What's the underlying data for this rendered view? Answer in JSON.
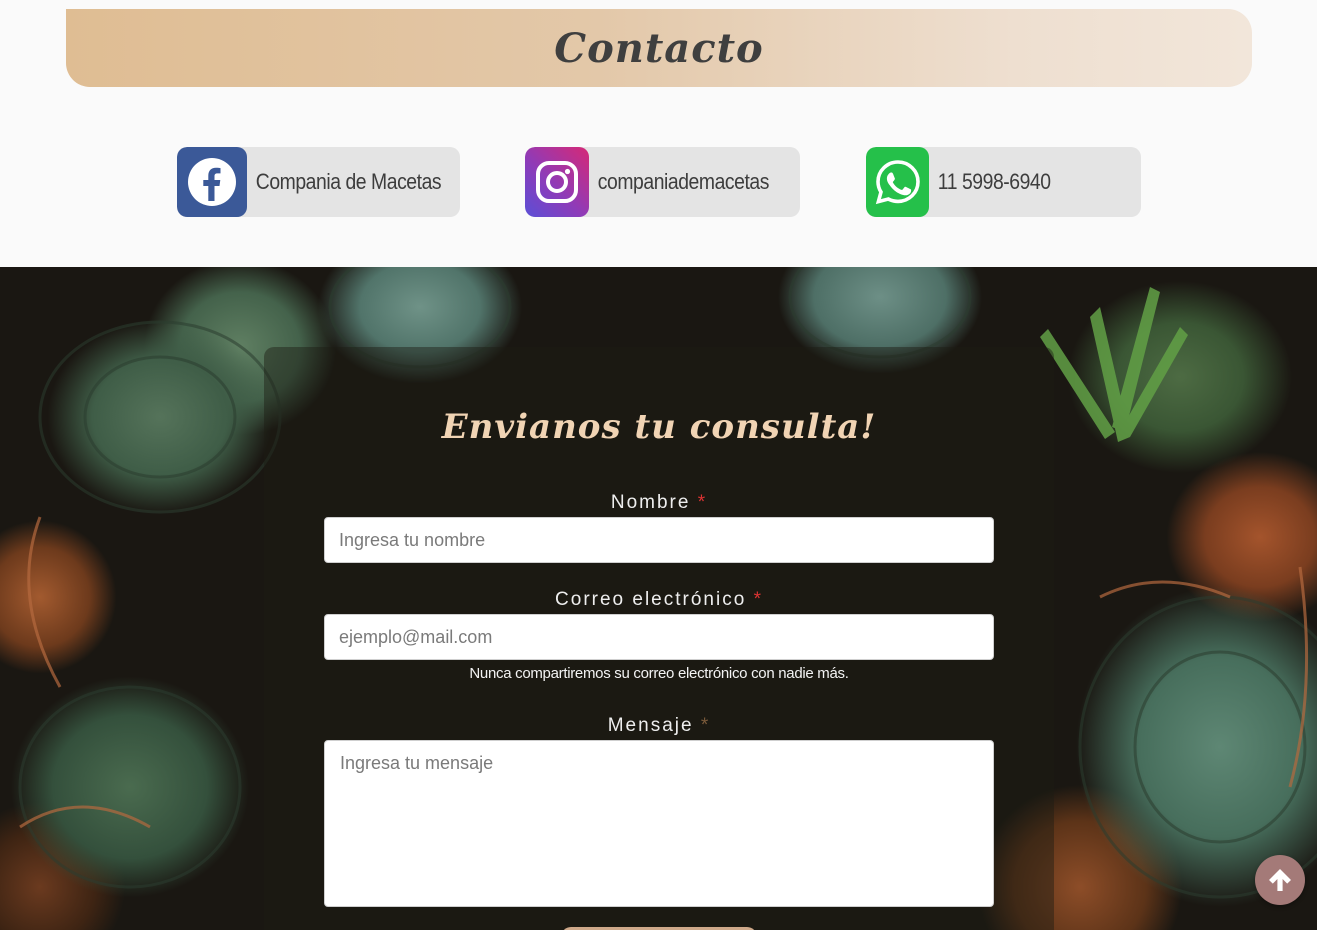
{
  "header": {
    "title": "Contacto"
  },
  "social": {
    "facebook": {
      "label": "Compania de Macetas",
      "icon": "facebook-icon",
      "color": "#3b5998"
    },
    "instagram": {
      "label": "companiademacetas",
      "icon": "instagram-icon",
      "color": "#c13584"
    },
    "whatsapp": {
      "label": "11 5998-6940",
      "icon": "whatsapp-icon",
      "color": "#25c04a"
    }
  },
  "form": {
    "title": "Envianos tu consulta!",
    "name": {
      "label": "Nombre",
      "required_mark": "*",
      "placeholder": "Ingresa tu nombre"
    },
    "email": {
      "label": "Correo electrónico",
      "required_mark": "*",
      "placeholder": "ejemplo@mail.com",
      "help": "Nunca compartiremos su correo electrónico con nadie más."
    },
    "message": {
      "label": "Mensaje",
      "required_mark": "*",
      "placeholder": "Ingresa tu mensaje"
    }
  },
  "scroll_top": {
    "icon": "arrow-up-icon"
  },
  "colors": {
    "accent": "#dfbd93",
    "title_light": "#f1d4b4",
    "scroll_button": "#a47a78"
  }
}
